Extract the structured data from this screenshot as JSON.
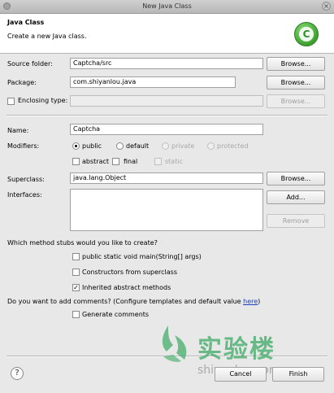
{
  "window": {
    "title": "New Java Class"
  },
  "header": {
    "title": "Java Class",
    "subtitle": "Create a new Java class."
  },
  "source_folder": {
    "label": "Source folder:",
    "value": "Captcha/src",
    "button": "Browse..."
  },
  "package": {
    "label": "Package:",
    "value": "com.shiyanlou.java",
    "button": "Browse..."
  },
  "enclosing_type": {
    "label": "Enclosing type:",
    "value": "",
    "button": "Browse...",
    "checked": false
  },
  "name": {
    "label": "Name:",
    "value": "Captcha"
  },
  "modifiers": {
    "label": "Modifiers:",
    "access": [
      "public",
      "default",
      "private",
      "protected"
    ],
    "selected": "public",
    "flags": [
      {
        "label": "abstract",
        "checked": false
      },
      {
        "label": "final",
        "checked": false
      },
      {
        "label": "static",
        "checked": false
      }
    ]
  },
  "superclass": {
    "label": "Superclass:",
    "value": "java.lang.Object",
    "button": "Browse..."
  },
  "interfaces": {
    "label": "Interfaces:",
    "add_button": "Add...",
    "remove_button": "Remove"
  },
  "stubs": {
    "question": "Which method stubs would you like to create?",
    "options": [
      {
        "label": "public static void main(String[] args)",
        "checked": false
      },
      {
        "label": "Constructors from superclass",
        "checked": false
      },
      {
        "label": "Inherited abstract methods",
        "checked": true
      }
    ]
  },
  "comments": {
    "question": "Do you want to add comments? (Configure templates and default value ",
    "link": "here",
    "question_end": ")",
    "option": {
      "label": "Generate comments",
      "checked": false
    }
  },
  "footer": {
    "help": "?",
    "cancel": "Cancel",
    "finish": "Finish"
  },
  "watermark": {
    "text": "实验楼",
    "url": "shiyanlou.com"
  }
}
